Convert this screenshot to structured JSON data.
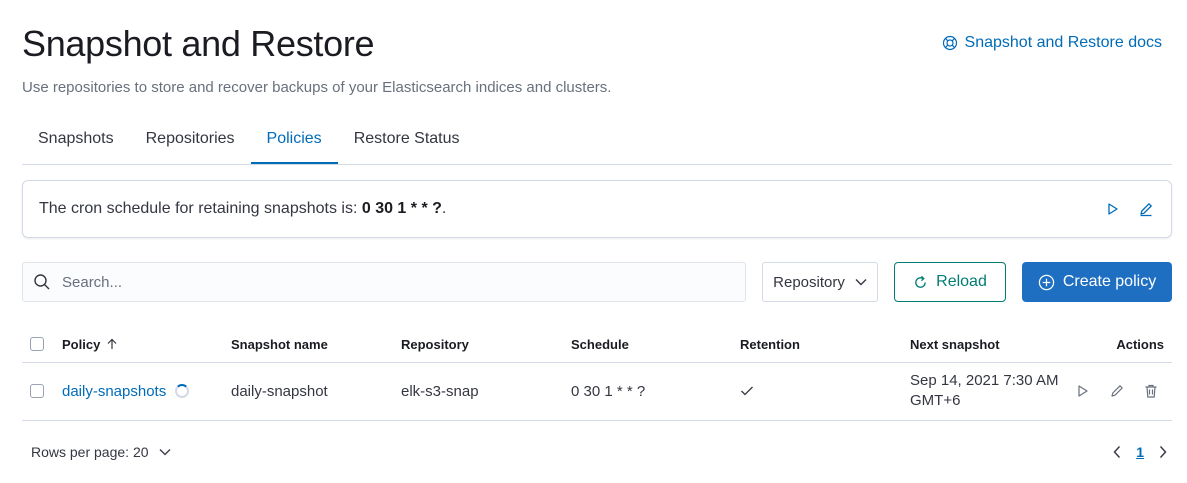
{
  "header": {
    "title": "Snapshot and Restore",
    "subtitle": "Use repositories to store and recover backups of your Elasticsearch indices and clusters.",
    "docs_link": "Snapshot and Restore docs"
  },
  "tabs": [
    {
      "label": "Snapshots",
      "active": false
    },
    {
      "label": "Repositories",
      "active": false
    },
    {
      "label": "Policies",
      "active": true
    },
    {
      "label": "Restore Status",
      "active": false
    }
  ],
  "callout": {
    "text": "The cron schedule for retaining snapshots is: ",
    "schedule": "0 30 1 * * ?",
    "suffix": "."
  },
  "toolbar": {
    "search_placeholder": "Search...",
    "repository_filter": "Repository",
    "reload_label": "Reload",
    "create_label": "Create policy"
  },
  "table": {
    "columns": [
      "Policy",
      "Snapshot name",
      "Repository",
      "Schedule",
      "Retention",
      "Next snapshot",
      "Actions"
    ],
    "rows": [
      {
        "policy": "daily-snapshots",
        "snapshot_name": "daily-snapshot",
        "repository": "elk-s3-snap",
        "schedule": "0 30 1 * * ?",
        "retention": "check",
        "next_snapshot_line1": "Sep 14, 2021 7:30 AM",
        "next_snapshot_line2": "GMT+6"
      }
    ]
  },
  "pagination": {
    "rows_per_page": "Rows per page: 20",
    "current_page": "1"
  },
  "colors": {
    "primary": "#006bb8",
    "success": "#017d73",
    "button_fill": "#1e6fc2",
    "border": "#d3dae6"
  }
}
